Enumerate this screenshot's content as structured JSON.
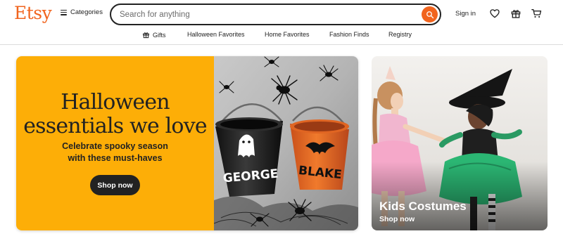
{
  "header": {
    "logo": "Etsy",
    "categories_label": "Categories",
    "search_placeholder": "Search for anything",
    "signin_label": "Sign in"
  },
  "nav": {
    "items": [
      {
        "label": "Gifts",
        "icon": "gift-icon"
      },
      {
        "label": "Halloween Favorites"
      },
      {
        "label": "Home Favorites"
      },
      {
        "label": "Fashion Finds"
      },
      {
        "label": "Registry"
      }
    ]
  },
  "hero": {
    "title_line1": "Halloween",
    "title_line2": "essentials we love",
    "subtitle_line1": "Celebrate spooky season",
    "subtitle_line2": "with these must-haves",
    "button_label": "Shop now",
    "bucket_left_text": "GEORGE",
    "bucket_right_text": "BLAKE"
  },
  "side_card": {
    "title": "Kids Costumes",
    "link_label": "Shop now"
  },
  "colors": {
    "brand": "#f1641e",
    "hero_bg": "#fdae07",
    "dark": "#222222"
  }
}
